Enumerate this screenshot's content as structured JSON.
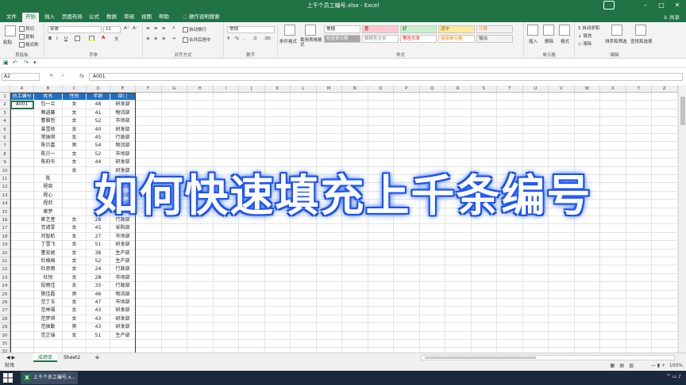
{
  "window": {
    "title": "上千个员工编号.xlsx  -  Excel"
  },
  "tabs": [
    "文件",
    "开始",
    "插入",
    "页面布局",
    "公式",
    "数据",
    "审阅",
    "视图",
    "帮助",
    "操作说明搜索"
  ],
  "share_label": "共享",
  "ribbon": {
    "clipboard": {
      "label": "剪贴板",
      "paste": "粘贴",
      "cut": "剪切",
      "copy": "复制",
      "format_painter": "格式刷"
    },
    "font": {
      "label": "字体",
      "name": "宋体",
      "size": "11"
    },
    "alignment": {
      "label": "对齐方式",
      "wrap": "自动换行",
      "merge": "合并后居中"
    },
    "number": {
      "label": "数字",
      "format": "常规"
    },
    "styles": {
      "label": "样式",
      "conditional": "条件格式",
      "table": "套用表格格式",
      "cells": [
        {
          "text": "常规",
          "bg": "#ffffff",
          "color": "#000000"
        },
        {
          "text": "差",
          "bg": "#ffc7ce",
          "color": "#9c0006"
        },
        {
          "text": "好",
          "bg": "#c6efce",
          "color": "#006100"
        },
        {
          "text": "适中",
          "bg": "#ffeb9c",
          "color": "#9c5700"
        },
        {
          "text": "计算",
          "bg": "#f2f2f2",
          "color": "#fa7d00"
        },
        {
          "text": "检查单元格",
          "bg": "#a5a5a5",
          "color": "#ffffff"
        },
        {
          "text": "解释性文本",
          "bg": "#ffffff",
          "color": "#7f7f7f"
        },
        {
          "text": "警告文本",
          "bg": "#ffffff",
          "color": "#ff0000"
        },
        {
          "text": "链接单元格",
          "bg": "#ffffff",
          "color": "#fa7d00"
        },
        {
          "text": "输出",
          "bg": "#f2f2f2",
          "color": "#3f3f3f"
        }
      ]
    },
    "cells_group": {
      "label": "单元格",
      "insert": "插入",
      "delete": "删除",
      "format": "格式"
    },
    "editing": {
      "label": "编辑",
      "autosum": "自动求和",
      "fill": "填充",
      "clear": "清除",
      "sort": "排序和筛选",
      "find": "查找和选择"
    }
  },
  "formula_bar": {
    "name_box": "A2",
    "fx": "fx",
    "value": "A001"
  },
  "columns": [
    "A",
    "B",
    "C",
    "D",
    "E",
    "F",
    "G",
    "H",
    "I",
    "J",
    "K",
    "L",
    "M",
    "N",
    "O",
    "P",
    "Q",
    "R",
    "S",
    "T",
    "U",
    "V",
    "W",
    "X",
    "Y",
    "Z"
  ],
  "table": {
    "headers": [
      "员工编号",
      "姓名",
      "性别",
      "年龄",
      "部门"
    ],
    "rows": [
      [
        "A001",
        "包一兰",
        "女",
        "48",
        "研发部"
      ],
      [
        "",
        "蔡逍襄",
        "女",
        "41",
        "物流部"
      ],
      [
        "",
        "曹雅哲",
        "女",
        "52",
        "市场部"
      ],
      [
        "",
        "曾雪依",
        "女",
        "40",
        "研发部"
      ],
      [
        "",
        "常振琪",
        "女",
        "45",
        "行政部"
      ],
      [
        "",
        "陈贝嘉",
        "男",
        "54",
        "物流部"
      ],
      [
        "",
        "陈贝一",
        "女",
        "52",
        "市场部"
      ],
      [
        "",
        "陈府华",
        "女",
        "44",
        "研发部"
      ],
      [
        "",
        "",
        "女",
        "",
        "研发部"
      ],
      [
        "",
        "陈",
        "",
        "",
        "研发部"
      ],
      [
        "",
        "程晓",
        "",
        "",
        "行政部"
      ],
      [
        "",
        "程心",
        "",
        "",
        "研发部"
      ],
      [
        "",
        "程欣",
        "",
        "",
        "研发部"
      ],
      [
        "",
        "崔梦",
        "",
        "",
        "物流部"
      ],
      [
        "",
        "崔艺萱",
        "女",
        "28",
        "行政部"
      ],
      [
        "",
        "党靖雯",
        "女",
        "45",
        "采购部"
      ],
      [
        "",
        "邓智航",
        "女",
        "27",
        "市场部"
      ],
      [
        "",
        "丁雪飞",
        "女",
        "51",
        "研发部"
      ],
      [
        "",
        "董安妮",
        "女",
        "38",
        "生产部"
      ],
      [
        "",
        "杜格格",
        "女",
        "52",
        "生产部"
      ],
      [
        "",
        "杜思雨",
        "女",
        "24",
        "行政部"
      ],
      [
        "",
        "杜悦",
        "女",
        "28",
        "市场部"
      ],
      [
        "",
        "段雨佳",
        "女",
        "35",
        "行政部"
      ],
      [
        "",
        "樊佳磊",
        "男",
        "46",
        "物流部"
      ],
      [
        "",
        "范丁玉",
        "女",
        "47",
        "市场部"
      ],
      [
        "",
        "范林福",
        "女",
        "43",
        "研发部"
      ],
      [
        "",
        "范梦琪",
        "女",
        "43",
        "研发部"
      ],
      [
        "",
        "范振勤",
        "男",
        "43",
        "研发部"
      ],
      [
        "",
        "范芷瑞",
        "女",
        "51",
        "生产部"
      ]
    ]
  },
  "sheets": [
    "成绩单",
    "Sheet2"
  ],
  "status": {
    "text": "就绪",
    "zoom": "100%"
  },
  "taskbar": {
    "app": "上千个员工编号.x..."
  },
  "overlay_text": "如何快速填充上千条编号"
}
